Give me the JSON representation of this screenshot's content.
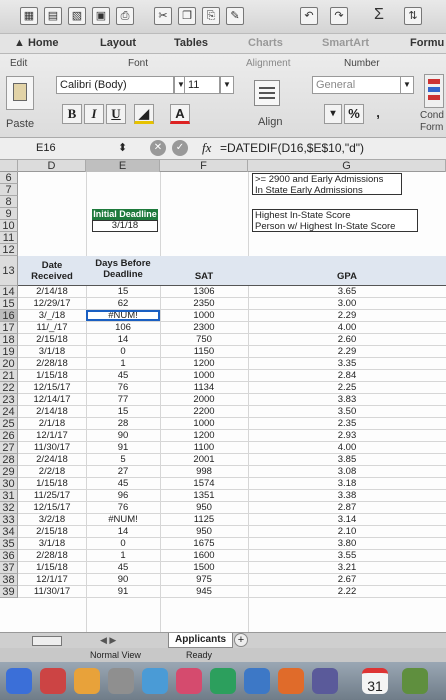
{
  "ribbon": {
    "tabs": [
      "Home",
      "Layout",
      "Tables",
      "Charts",
      "SmartArt",
      "Formu"
    ],
    "edit_label": "Edit",
    "font_group": "Font",
    "alignment_group": "Alignment",
    "number_group": "Number",
    "font_name": "Calibri (Body)",
    "font_size": "11",
    "number_format": "General",
    "paste_label": "Paste",
    "bold": "B",
    "italic": "I",
    "underline": "U",
    "align_label": "Align",
    "percent": "%",
    "comma": ",",
    "cond_line1": "Cond",
    "cond_line2": "Form"
  },
  "formula_bar": {
    "cell_ref": "E16",
    "fx": "fx",
    "formula": "=DATEDIF(D16,$E$10,\"d\")"
  },
  "columns": [
    "D",
    "E",
    "F",
    "G"
  ],
  "upper": {
    "row_numbers": [
      "6",
      "7",
      "8",
      "9",
      "10",
      "11",
      "12"
    ],
    "g6": ">= 2900 and Early Admissions",
    "g7": "In State Early Admissions",
    "e9": "Initial Deadline",
    "e10": "3/1/18",
    "g9": "Highest In-State Score",
    "g10": "Person w/ Highest In-State Score"
  },
  "table": {
    "header_row": "13",
    "headers": {
      "date_line1": "Date",
      "date_line2": "Received",
      "days_line1": "Days Before",
      "days_line2": "Deadline",
      "sat": "SAT",
      "gpa": "GPA"
    },
    "rows": [
      {
        "n": "14",
        "date": "2/14/18",
        "days": "15",
        "sat": "1306",
        "gpa": "3.65"
      },
      {
        "n": "15",
        "date": "12/29/17",
        "days": "62",
        "sat": "2350",
        "gpa": "3.00"
      },
      {
        "n": "16",
        "date": "3/_/18",
        "days": "#NUM!",
        "sat": "1000",
        "gpa": "2.29"
      },
      {
        "n": "17",
        "date": "11/_/17",
        "days": "106",
        "sat": "2300",
        "gpa": "4.00"
      },
      {
        "n": "18",
        "date": "2/15/18",
        "days": "14",
        "sat": "750",
        "gpa": "2.60"
      },
      {
        "n": "19",
        "date": "3/1/18",
        "days": "0",
        "sat": "1150",
        "gpa": "2.29"
      },
      {
        "n": "20",
        "date": "2/28/18",
        "days": "1",
        "sat": "1200",
        "gpa": "3.35"
      },
      {
        "n": "21",
        "date": "1/15/18",
        "days": "45",
        "sat": "1000",
        "gpa": "2.84"
      },
      {
        "n": "22",
        "date": "12/15/17",
        "days": "76",
        "sat": "1134",
        "gpa": "2.25"
      },
      {
        "n": "23",
        "date": "12/14/17",
        "days": "77",
        "sat": "2000",
        "gpa": "3.83"
      },
      {
        "n": "24",
        "date": "2/14/18",
        "days": "15",
        "sat": "2200",
        "gpa": "3.50"
      },
      {
        "n": "25",
        "date": "2/1/18",
        "days": "28",
        "sat": "1000",
        "gpa": "2.35"
      },
      {
        "n": "26",
        "date": "12/1/17",
        "days": "90",
        "sat": "1200",
        "gpa": "2.93"
      },
      {
        "n": "27",
        "date": "11/30/17",
        "days": "91",
        "sat": "1100",
        "gpa": "4.00"
      },
      {
        "n": "28",
        "date": "2/24/18",
        "days": "5",
        "sat": "2001",
        "gpa": "3.85"
      },
      {
        "n": "29",
        "date": "2/2/18",
        "days": "27",
        "sat": "998",
        "gpa": "3.08"
      },
      {
        "n": "30",
        "date": "1/15/18",
        "days": "45",
        "sat": "1574",
        "gpa": "3.18"
      },
      {
        "n": "31",
        "date": "11/25/17",
        "days": "96",
        "sat": "1351",
        "gpa": "3.38"
      },
      {
        "n": "32",
        "date": "12/15/17",
        "days": "76",
        "sat": "950",
        "gpa": "2.87"
      },
      {
        "n": "33",
        "date": "3/2/18",
        "days": "#NUM!",
        "sat": "1125",
        "gpa": "3.14"
      },
      {
        "n": "34",
        "date": "2/15/18",
        "days": "14",
        "sat": "950",
        "gpa": "2.10"
      },
      {
        "n": "35",
        "date": "3/1/18",
        "days": "0",
        "sat": "1675",
        "gpa": "3.80"
      },
      {
        "n": "36",
        "date": "2/28/18",
        "days": "1",
        "sat": "1600",
        "gpa": "3.55"
      },
      {
        "n": "37",
        "date": "1/15/18",
        "days": "45",
        "sat": "1500",
        "gpa": "3.21"
      },
      {
        "n": "38",
        "date": "12/1/17",
        "days": "90",
        "sat": "975",
        "gpa": "2.67"
      },
      {
        "n": "39",
        "date": "11/30/17",
        "days": "91",
        "sat": "945",
        "gpa": "2.22"
      }
    ]
  },
  "sheet_tab": "Applicants",
  "status": {
    "view": "Normal View",
    "ready": "Ready"
  },
  "dock": {
    "calendar_day": "31"
  },
  "colors": {
    "deadline_header": "#1e7a3c",
    "ribbon": "#e0e0e0",
    "selected_header": "#bcbcbc"
  }
}
